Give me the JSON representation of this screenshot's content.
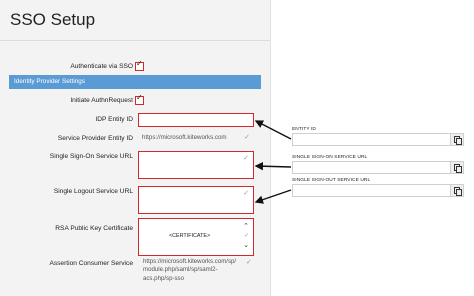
{
  "page": {
    "title": "SSO Setup"
  },
  "form": {
    "authenticate_label": "Authenticate via SSO",
    "section_header": "Identity Provider Settings",
    "initiate_label": "Initiate AuthnRequest",
    "idp_entity_label": "IDP Entity ID",
    "sp_entity_label": "Service Provider Entity ID",
    "sp_entity_value": "https://microsoft.kiteworks.com",
    "sso_url_label": "Single Sign-On Service URL",
    "slo_url_label": "Single Logout Service URL",
    "rsa_label": "RSA Public Key Certificate",
    "rsa_value": "<CERTIFICATE>",
    "acs_label": "Assertion Consumer Service",
    "acs_lines": [
      "https://microsoft.kiteworks.com/sp/",
      "module.php/saml/sp/saml2-",
      "acs.php/sp-sso"
    ]
  },
  "icons": {
    "checkmark": "✓",
    "scroll_up": "⌃",
    "scroll_down": "⌄",
    "copy": "copy-icon"
  },
  "callouts": {
    "entity_id_label": "ENTITY ID",
    "sso_url_label": "SINGLE SIGN-ON SERVICE URL",
    "slo_url_label": "SINGLE SIGN-OUT SERVICE URL"
  },
  "colors": {
    "highlight": "#d0282c",
    "section_bg": "#5b9bd5"
  }
}
